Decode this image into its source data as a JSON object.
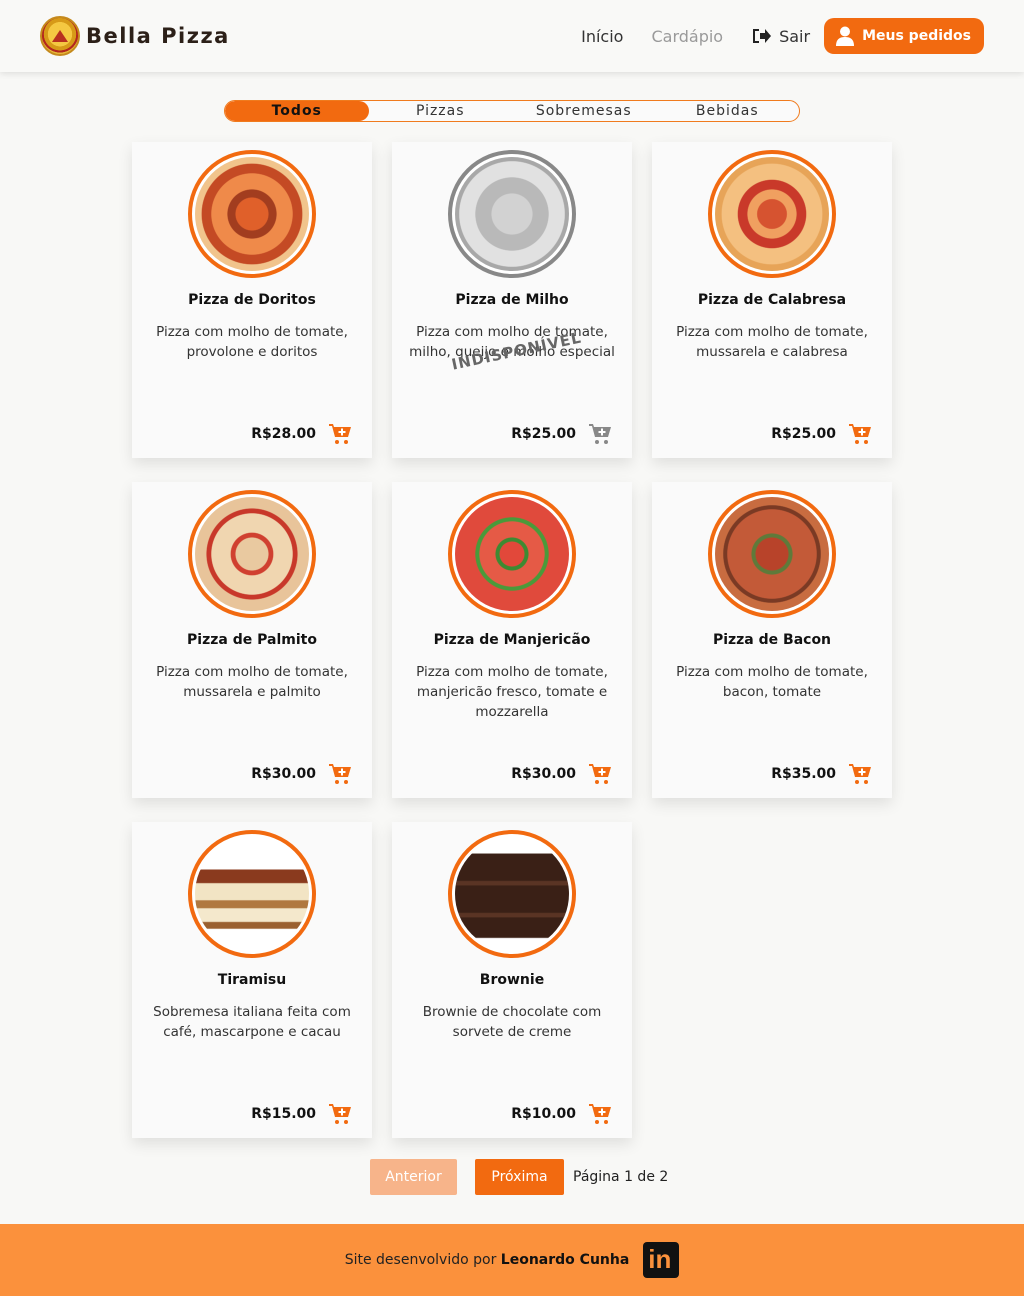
{
  "header": {
    "brand": "Bella Pizza",
    "nav": {
      "home": "Início",
      "menu": "Cardápio",
      "logout": "Sair",
      "orders": "Meus pedidos"
    }
  },
  "tabs": [
    {
      "label": "Todos",
      "active": true
    },
    {
      "label": "Pizzas",
      "active": false
    },
    {
      "label": "Sobremesas",
      "active": false
    },
    {
      "label": "Bebidas",
      "active": false
    }
  ],
  "products": [
    {
      "name": "Pizza de Doritos",
      "description": "Pizza com molho de tomate, provolone e doritos",
      "price": "R$28.00",
      "available": true,
      "image": "pizza-doritos"
    },
    {
      "name": "Pizza de Milho",
      "description": "Pizza com molho de tomate, milho, queijo e molho especial",
      "price": "R$25.00",
      "available": false,
      "unavailable_label": "INDISPONÍVEL",
      "image": "pizza-milho"
    },
    {
      "name": "Pizza de Calabresa",
      "description": "Pizza com molho de tomate, mussarela e calabresa",
      "price": "R$25.00",
      "available": true,
      "image": "pizza-calabresa"
    },
    {
      "name": "Pizza de Palmito",
      "description": "Pizza com molho de tomate, mussarela e palmito",
      "price": "R$30.00",
      "available": true,
      "image": "pizza-palmito"
    },
    {
      "name": "Pizza de Manjericão",
      "description": "Pizza com molho de tomate, manjericão fresco, tomate e mozzarella",
      "price": "R$30.00",
      "available": true,
      "image": "pizza-manjericao"
    },
    {
      "name": "Pizza de Bacon",
      "description": "Pizza com molho de tomate, bacon, tomate",
      "price": "R$35.00",
      "available": true,
      "image": "pizza-bacon"
    },
    {
      "name": "Tiramisu",
      "description": "Sobremesa italiana feita com café, mascarpone e cacau",
      "price": "R$15.00",
      "available": true,
      "image": "tiramisu"
    },
    {
      "name": "Brownie",
      "description": "Brownie de chocolate com sorvete de creme",
      "price": "R$10.00",
      "available": true,
      "image": "brownie"
    }
  ],
  "pagination": {
    "prev": "Anterior",
    "next": "Próxima",
    "label": "Página 1 de 2"
  },
  "footer": {
    "text": "Site desenvolvido por",
    "author": "Leonardo Cunha",
    "social_icon": "linkedin-icon"
  },
  "colors": {
    "accent": "#f26a10",
    "footer_bg": "#fb913c",
    "prev_disabled": "#f7b48a"
  }
}
